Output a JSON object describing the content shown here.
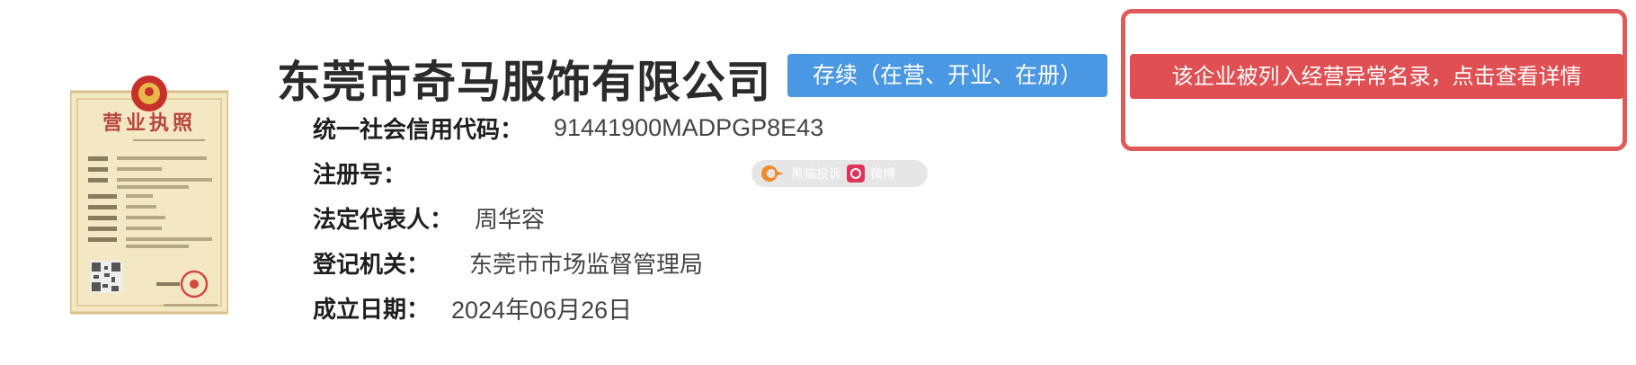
{
  "company": {
    "name": "东莞市奇马服饰有限公司",
    "status": "存续（在营、开业、在册）",
    "abnormal_notice": "该企业被列入经营异常名录，点击查看详情"
  },
  "license_image": {
    "title": "营业执照"
  },
  "fields": {
    "credit_code": {
      "label": "统一社会信用代码：",
      "value": "91441900MADPGP8E43"
    },
    "registration_number": {
      "label": "注册号：",
      "value": ""
    },
    "legal_representative": {
      "label": "法定代表人：",
      "value": "周华容"
    },
    "registration_authority": {
      "label": "登记机关：",
      "value": "东莞市市场监督管理局"
    },
    "establishment_date": {
      "label": "成立日期：",
      "value": "2024年06月26日"
    }
  },
  "watermark": {
    "left_text": "黑猫投诉",
    "right_text": "微博"
  },
  "colors": {
    "status_blue": "#4a97e3",
    "alert_red": "#e04f52",
    "frame_red": "#e05a5a"
  }
}
